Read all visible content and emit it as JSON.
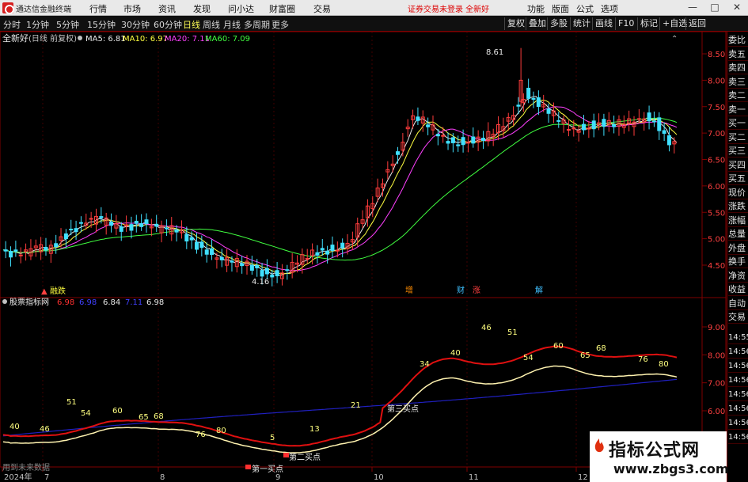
{
  "titlebar": {
    "app_name": "通达信金融终端",
    "menus": [
      "行情",
      "市场",
      "资讯",
      "发现",
      "问小达",
      "财富圈",
      "交易"
    ],
    "notice": "证券交易未登录  全新好",
    "right_menus": [
      "功能",
      "版面",
      "公式",
      "选项"
    ],
    "window_buttons": [
      "—",
      "□",
      "✕"
    ]
  },
  "toolbar": {
    "periods": [
      "分时",
      "1分钟",
      "5分钟",
      "15分钟",
      "30分钟",
      "60分钟",
      "日线",
      "周线",
      "月线",
      "多周期",
      "更多"
    ],
    "active_period": "日线",
    "buttons": [
      "复权",
      "叠加",
      "多股",
      "统计",
      "画线",
      "F10",
      "标记",
      "+自选",
      "返回"
    ]
  },
  "main_panel": {
    "stock_name": "全新好",
    "adjust_mode": "(日线 前复权)",
    "ma_legend": [
      {
        "label": "MA5: 6.81",
        "color": "#e8e8e8"
      },
      {
        "label": "MA10: 6.97",
        "color": "#ffff40"
      },
      {
        "label": "MA20: 7.11",
        "color": "#ff40ff"
      },
      {
        "label": "MA60: 7.09",
        "color": "#40ff40"
      }
    ],
    "high_label": "8.61",
    "low_label": "4.16",
    "y_ticks": [
      "8.50",
      "8.00",
      "7.50",
      "7.00",
      "6.50",
      "6.00",
      "5.50",
      "5.00",
      "4.50"
    ],
    "markers": [
      {
        "text": "融跌",
        "color": "#ffff40"
      },
      {
        "text": "增",
        "color": "#ff8c00"
      },
      {
        "text": "财",
        "color": "#40c0ff"
      },
      {
        "text": "涨",
        "color": "#ff4040"
      },
      {
        "text": "解",
        "color": "#40c0ff"
      }
    ]
  },
  "sub_panel": {
    "indicator_name": "股票指标网",
    "values": [
      {
        "label": "6.98",
        "color": "#ff3030"
      },
      {
        "label": "6.98",
        "color": "#4040ff"
      },
      {
        "label": "6.84",
        "color": "#e8e8e8"
      },
      {
        "label": "7.11",
        "color": "#4040ff"
      },
      {
        "label": "6.98",
        "color": "#e8e8e8"
      }
    ],
    "y_ticks": [
      "9.00",
      "8.00",
      "7.00",
      "6.00"
    ],
    "numbers": [
      {
        "text": "40"
      },
      {
        "text": "46"
      },
      {
        "text": "51"
      },
      {
        "text": "54"
      },
      {
        "text": "60"
      },
      {
        "text": "65"
      },
      {
        "text": "68"
      },
      {
        "text": "76"
      },
      {
        "text": "80"
      },
      {
        "text": "5"
      },
      {
        "text": "13"
      },
      {
        "text": "21"
      },
      {
        "text": "34"
      },
      {
        "text": "40"
      },
      {
        "text": "46"
      },
      {
        "text": "51"
      },
      {
        "text": "54"
      },
      {
        "text": "60"
      },
      {
        "text": "65"
      },
      {
        "text": "68"
      },
      {
        "text": "76"
      },
      {
        "text": "80"
      }
    ],
    "annotations": [
      "第一买点",
      "第二买点",
      "第三买点"
    ]
  },
  "time_axis": {
    "labels": [
      "2024年",
      "7",
      "8",
      "9",
      "10",
      "11",
      "12"
    ],
    "right_times": [
      "14:55",
      "14:56",
      "14:56",
      "14:56",
      "14:56",
      "14:56",
      "14:56",
      "14:56"
    ]
  },
  "sidebar": {
    "items": [
      "委比",
      "卖五",
      "卖四",
      "卖三",
      "卖二",
      "卖一",
      "买一",
      "买二",
      "买三",
      "买四",
      "买五",
      "现价",
      "涨跌",
      "涨幅",
      "总量",
      "外盘",
      "换手",
      "净资",
      "收益",
      "自动",
      "交易"
    ]
  },
  "footer_hint": "用到未来数据",
  "watermark": {
    "title": "指标公式网",
    "url": "www.zbgs3.com"
  },
  "colors": {
    "up": "#ff3c3c",
    "down": "#40e0ff",
    "grid": "#800000",
    "ma5": "#e8e8e8",
    "ma10": "#ffff40",
    "ma20": "#ff40ff",
    "ma60": "#40ff40",
    "ind_red": "#e01010",
    "ind_yellow": "#fff3b0",
    "ind_blue": "#2020c0"
  }
}
